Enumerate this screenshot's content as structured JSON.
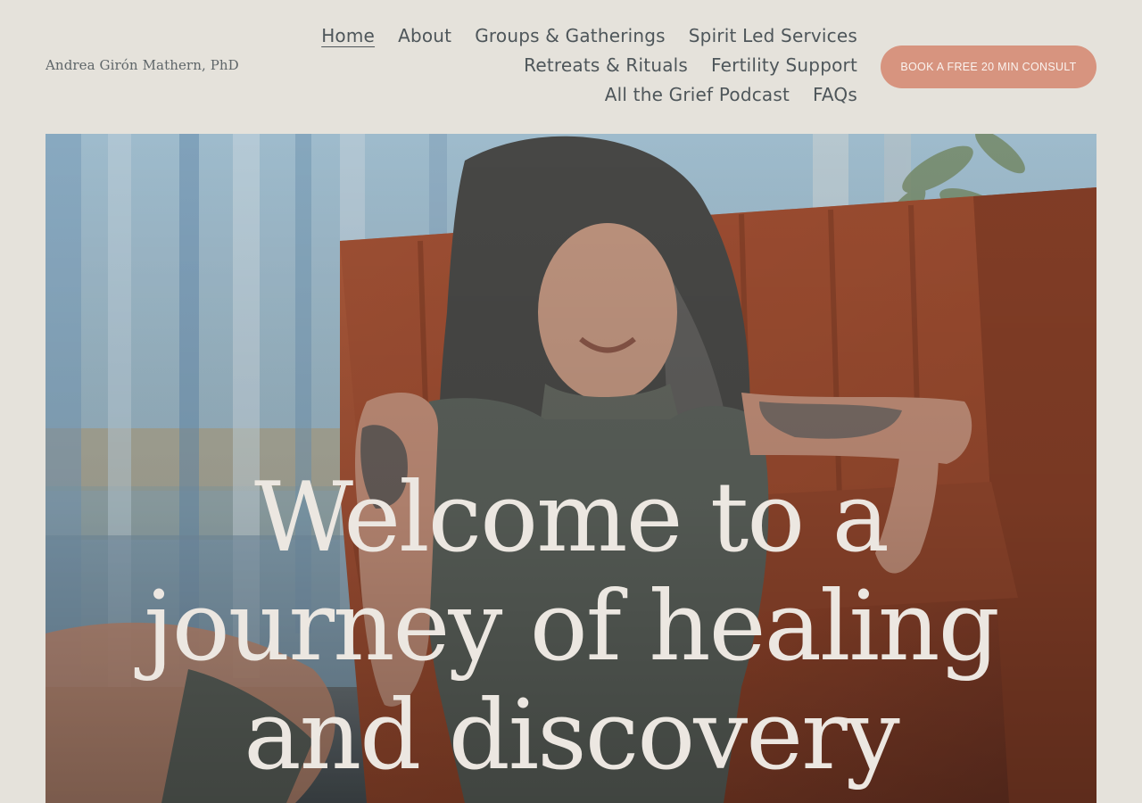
{
  "header": {
    "site_title": "Andrea Girón Mathern, PhD",
    "nav": [
      [
        {
          "label": "Home",
          "active": true
        },
        {
          "label": "About",
          "active": false
        },
        {
          "label": "Groups & Gatherings",
          "active": false
        },
        {
          "label": "Spirit Led Services",
          "active": false
        }
      ],
      [
        {
          "label": "Retreats & Rituals",
          "active": false
        },
        {
          "label": "Fertility Support",
          "active": false
        }
      ],
      [
        {
          "label": "All the Grief Podcast",
          "active": false
        },
        {
          "label": "FAQs",
          "active": false
        }
      ]
    ],
    "cta_label": "BOOK A FREE 20 MIN CONSULT"
  },
  "hero": {
    "title_lines": [
      "Welcome to a",
      "journey of healing",
      "and discovery"
    ]
  },
  "colors": {
    "background": "#e5e2db",
    "cta": "#d7947f",
    "nav_text": "#4e565a",
    "hero_text": "#ece7e1"
  }
}
